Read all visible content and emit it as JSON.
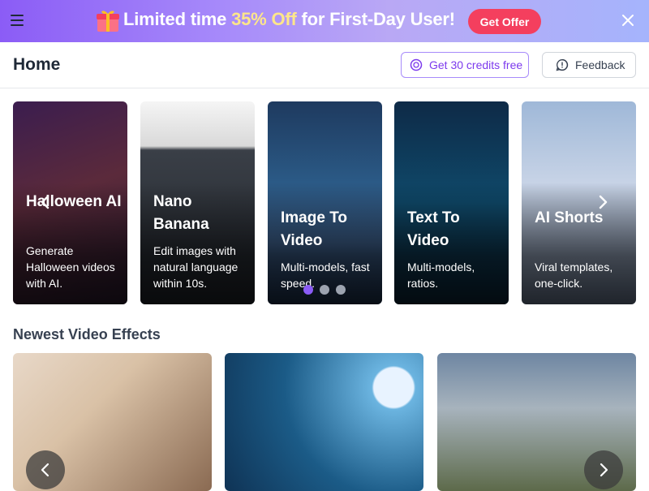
{
  "banner": {
    "text_before": "Limited time ",
    "text_highlight": "35% Off",
    "text_after": " for First-Day User!",
    "offer_label": "Get Offer",
    "menu_icon": "menu-icon",
    "gift_icon": "gift-icon",
    "close_icon": "close-icon",
    "colors": {
      "offer": "#f43f5e",
      "highlight": "#fde68a"
    }
  },
  "header": {
    "title": "Home",
    "credits_label": "Get 30 credits free",
    "feedback_label": "Feedback"
  },
  "features": {
    "cards": [
      {
        "title": "Halloween AI",
        "description": "Generate Halloween videos with AI."
      },
      {
        "title": "Nano Banana",
        "description": "Edit images with natural language within 10s."
      },
      {
        "title": "Image To Video",
        "description": "Multi-models, fast speed."
      },
      {
        "title": "Text To Video",
        "description": "Multi-models, ratios."
      },
      {
        "title": "AI Shorts",
        "description": "Viral templates, one-click."
      }
    ],
    "active_dot": 1,
    "dot_count": 3
  },
  "effects": {
    "title": "Newest Video Effects"
  },
  "colors": {
    "accent": "#8b5cf6"
  }
}
